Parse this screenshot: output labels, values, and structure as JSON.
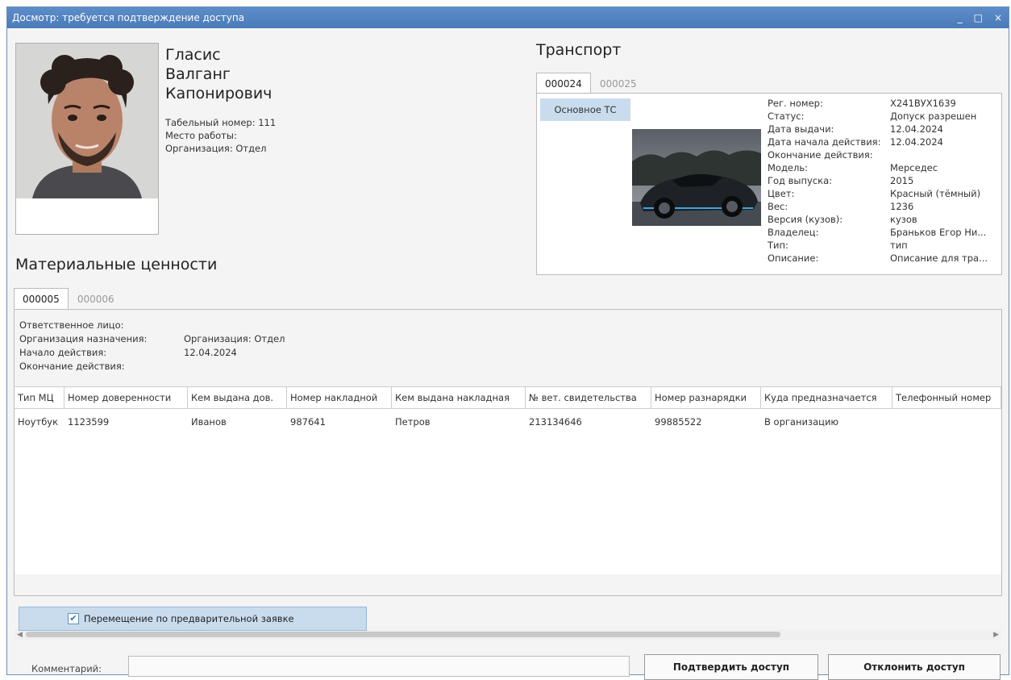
{
  "window": {
    "title": "Досмотр: требуется подтверждение доступа",
    "minimize": "_",
    "maximize": "□",
    "close": "×"
  },
  "person": {
    "last_name": "Гласис",
    "first_name": "Валганг",
    "patronymic": "Капонирович",
    "tab_number": "Табельный номер: 111",
    "workplace": "Место работы:",
    "organization": "Организация: Отдел"
  },
  "transport": {
    "title": "Транспорт",
    "tabs": [
      "000024",
      "000025"
    ],
    "subtab": "Основное ТС",
    "fields": [
      {
        "label": "Рег. номер:",
        "value": "Х241ВУХ1639"
      },
      {
        "label": "Статус:",
        "value": "Допуск разрешен"
      },
      {
        "label": "Дата выдачи:",
        "value": "12.04.2024"
      },
      {
        "label": "Дата начала действия:",
        "value": "12.04.2024"
      },
      {
        "label": "Окончание действия:",
        "value": ""
      },
      {
        "label": "Модель:",
        "value": "Мерседес"
      },
      {
        "label": "Год выпуска:",
        "value": "2015"
      },
      {
        "label": "Цвет:",
        "value": "Красный (тёмный)"
      },
      {
        "label": "Вес:",
        "value": "1236"
      },
      {
        "label": "Версия (кузов):",
        "value": "кузов"
      },
      {
        "label": "Владелец:",
        "value": "Браньков Егор Ни..."
      },
      {
        "label": "Тип:",
        "value": "тип"
      },
      {
        "label": "Описание:",
        "value": "Описание для тра..."
      }
    ]
  },
  "materials": {
    "title": "Материальные ценности",
    "tabs": [
      "000005",
      "000006"
    ],
    "responsible_label": "Ответственное лицо:",
    "responsible_value": "",
    "org_label": "Организация назначения:",
    "org_value": "Организация: Отдел",
    "start_label": "Начало действия:",
    "start_value": "12.04.2024",
    "end_label": "Окончание действия:",
    "end_value": "",
    "columns": [
      "Тип МЦ",
      "Номер доверенности",
      "Кем выдана дов.",
      "Номер накладной",
      "Кем выдана накладная",
      "№ вет. свидетельства",
      "Номер разнарядки",
      "Куда предназначается",
      "Телефонный номер"
    ],
    "rows": [
      [
        "Ноутбук",
        "1123599",
        "Иванов",
        "987641",
        "Петров",
        "213134646",
        "99885522",
        "В организацию",
        ""
      ]
    ]
  },
  "precheck": {
    "label": "Перемещение по предварительной заявке",
    "checked": true
  },
  "comment": {
    "label": "Комментарий:",
    "value": ""
  },
  "buttons": {
    "confirm": "Подтвердить доступ",
    "reject": "Отклонить доступ"
  }
}
